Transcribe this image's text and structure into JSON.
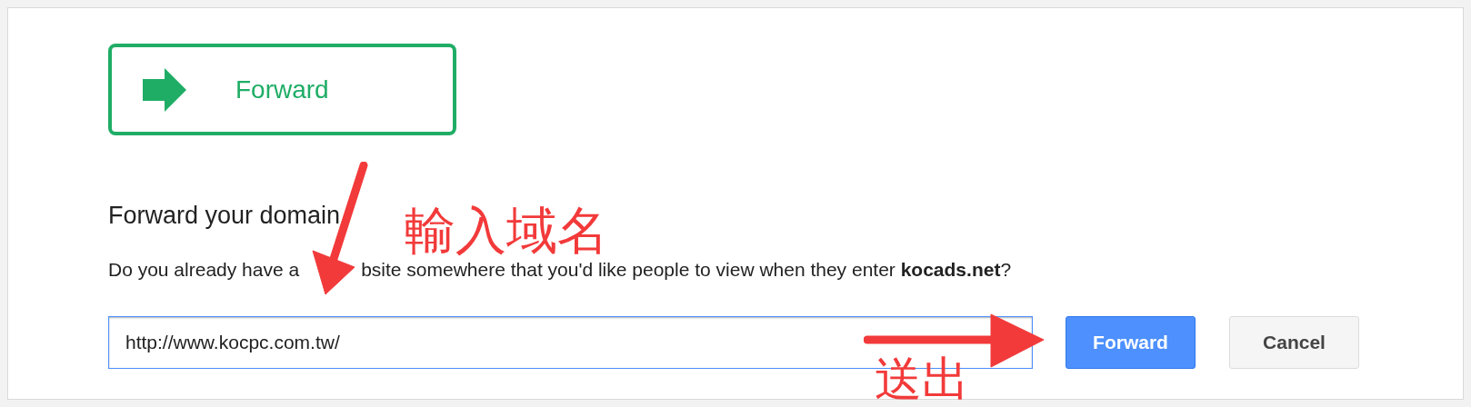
{
  "option_card": {
    "label": "Forward",
    "selected": true
  },
  "section": {
    "heading": "Forward your domain",
    "question_start": "Do you already have a",
    "question_end": "bsite somewhere that you'd like people to view when they enter **kocads.net**?"
  },
  "url_field": {
    "value": "http://www.kocpc.com.tw/",
    "focused": true
  },
  "buttons": [
    {
      "label": "Forward",
      "kind": "primary"
    },
    {
      "label": "Cancel",
      "kind": "secondary"
    }
  ],
  "annotations": [
    {
      "text": "輸入域名",
      "kind": "down"
    },
    {
      "text": "送出",
      "kind": "right"
    }
  ]
}
